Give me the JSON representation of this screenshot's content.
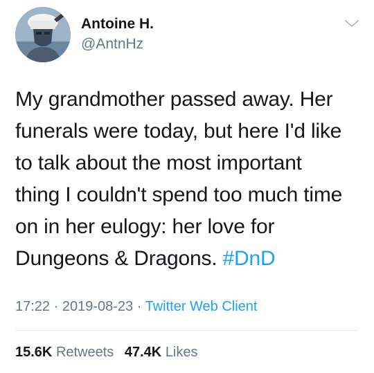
{
  "author": {
    "display_name": "Antoine H.",
    "handle": "@AntnHz"
  },
  "tweet": {
    "text_lines": [
      "My grandmother passed away. Her",
      "funerals were today, but here I'd like",
      "to talk about the most important",
      "thing I couldn't spend too much time",
      "on in her eulogy: her love for"
    ],
    "last_line_prefix": "Dungeons & Dragons. ",
    "hashtag": "#DnD"
  },
  "meta": {
    "time": "17:22",
    "date": "2019-08-23",
    "separator": " · ",
    "client": "Twitter Web Client"
  },
  "stats": {
    "retweets_count": "15.6K",
    "retweets_label": "Retweets",
    "likes_count": "47.4K",
    "likes_label": "Likes"
  },
  "colors": {
    "link": "#1da1f2",
    "secondary_text": "#657786",
    "primary_text": "#14171a",
    "divider": "#e1e8ed"
  },
  "icons": {
    "more_menu": "chevron-down-icon"
  }
}
